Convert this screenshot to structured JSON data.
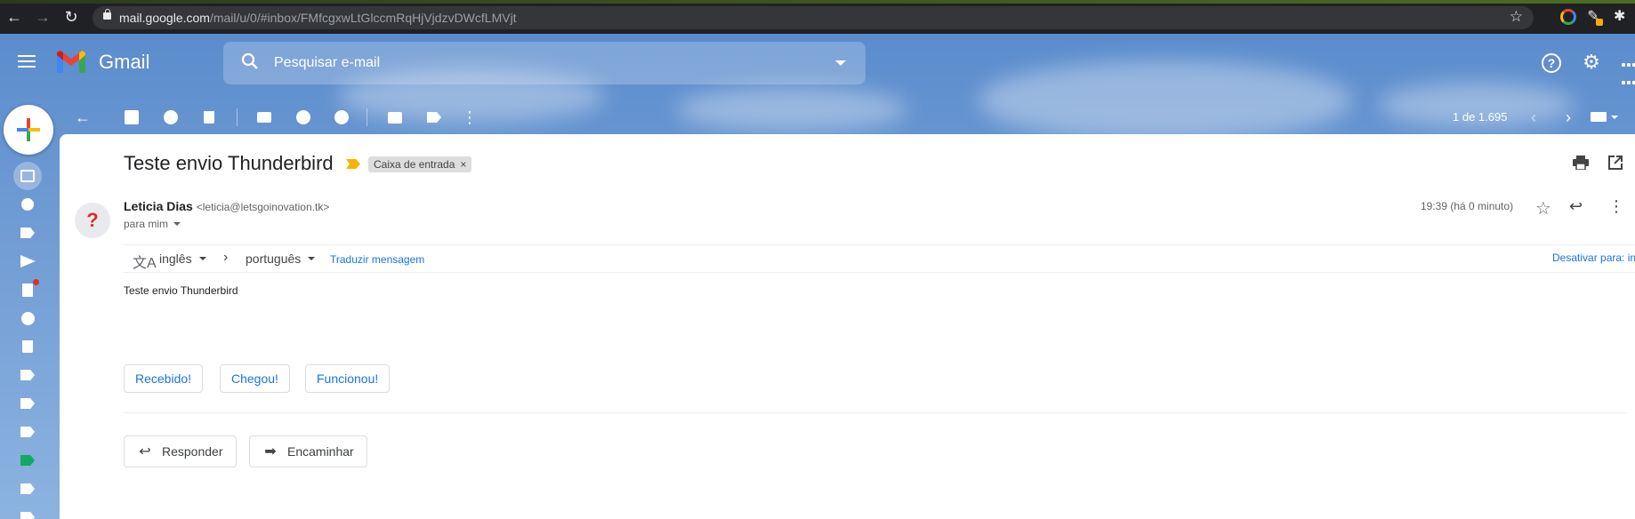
{
  "browser": {
    "url_host": "mail.google.com",
    "url_path": "/mail/u/0/#inbox/FMfcgxwLtGlccmRqHjVjdzvDWcfLMVjt"
  },
  "header": {
    "app_name": "Gmail",
    "search_placeholder": "Pesquisar e-mail"
  },
  "toolbar": {
    "pager": "1 de 1.695"
  },
  "message": {
    "subject": "Teste envio Thunderbird",
    "label": "Caixa de entrada",
    "label_close": "×",
    "sender_name": "Leticia Dias",
    "sender_email": "<leticia@letsgoinovation.tk>",
    "to": "para mim",
    "time": "19:39 (há 0 minuto)",
    "avatar_glyph": "?",
    "body": "Teste envio Thunderbird"
  },
  "translate": {
    "source_lang": "inglês",
    "target_lang": "português",
    "translate_link": "Traduzir mensagem",
    "disable_link": "Desativar para: inglês",
    "close": "×"
  },
  "smart_replies": [
    "Recebido!",
    "Chegou!",
    "Funcionou!"
  ],
  "actions": {
    "reply": "Responder",
    "forward": "Encaminhar"
  },
  "colors": {
    "accent_blue": "#1a73e8",
    "important_yellow": "#f4b400",
    "draft_dot_red": "#d93025",
    "label_green": "#16a765"
  }
}
